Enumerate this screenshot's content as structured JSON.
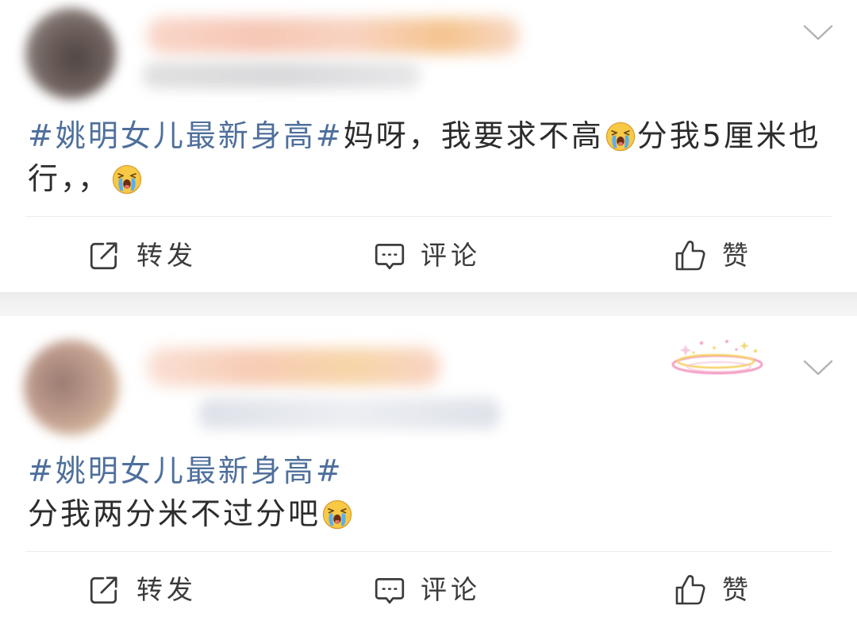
{
  "colors": {
    "hashtag": "#4e6f9c",
    "body_text": "#2c2c2c",
    "action_text": "#3b3b3b",
    "icon_stroke": "#3b3b3b",
    "chevron": "#b3b3b3",
    "divider": "#ececec",
    "feed_separator": "#f1f1f1",
    "emoji_face": "#f7c945",
    "emoji_tears": "#5aaef0"
  },
  "icons": {
    "menu": "chevron-down-icon",
    "repost": "repost-icon",
    "comment": "comment-icon",
    "like": "like-icon",
    "emoji": "crying-face-icon",
    "sticker": "halo-sticker-icon"
  },
  "posts": [
    {
      "content": {
        "hashtag": "#姚明女儿最新身高#",
        "segments": [
          "妈呀，我要求不高",
          "分我5厘米也",
          "行，，"
        ]
      },
      "actions": {
        "repost": "转发",
        "comment": "评论",
        "like": "赞"
      }
    },
    {
      "content": {
        "hashtag": "#姚明女儿最新身高#",
        "segments": [
          "分我两分米不过分吧"
        ]
      },
      "actions": {
        "repost": "转发",
        "comment": "评论",
        "like": "赞"
      }
    }
  ]
}
